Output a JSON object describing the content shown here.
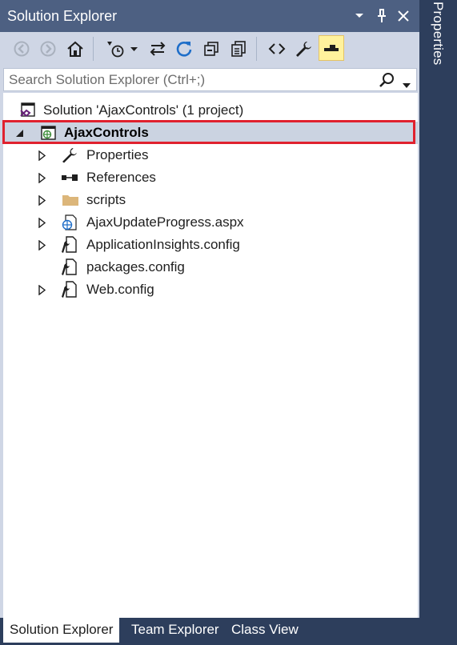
{
  "window": {
    "title": "Solution Explorer",
    "side_tab": "Properties"
  },
  "toolbar": {
    "buttons": [
      "back-icon",
      "forward-icon",
      "home-icon",
      "pending-changes-filter-icon",
      "sync-with-active-document-icon",
      "refresh-icon",
      "collapse-all-icon",
      "show-all-files-icon",
      "view-code-icon",
      "properties-wrench-icon",
      "preview-selected-items-icon"
    ],
    "active": "preview-selected-items-icon"
  },
  "search": {
    "placeholder": "Search Solution Explorer (Ctrl+;)"
  },
  "tree": {
    "solution_label": "Solution 'AjaxControls' (1 project)",
    "project_label": "AjaxControls",
    "items": [
      {
        "label": "Properties"
      },
      {
        "label": "References"
      },
      {
        "label": "scripts"
      },
      {
        "label": "AjaxUpdateProgress.aspx"
      },
      {
        "label": "ApplicationInsights.config"
      },
      {
        "label": "packages.config"
      },
      {
        "label": "Web.config"
      }
    ]
  },
  "tabs": [
    "Solution Explorer",
    "Team Explorer",
    "Class View"
  ],
  "colors": {
    "title_bar": "#4d6082",
    "background": "#2d3e5c",
    "toolbar": "#cfd6e5",
    "selection": "#cbd3e1",
    "highlight_border": "#e0212e",
    "active_button": "#fff29d"
  }
}
